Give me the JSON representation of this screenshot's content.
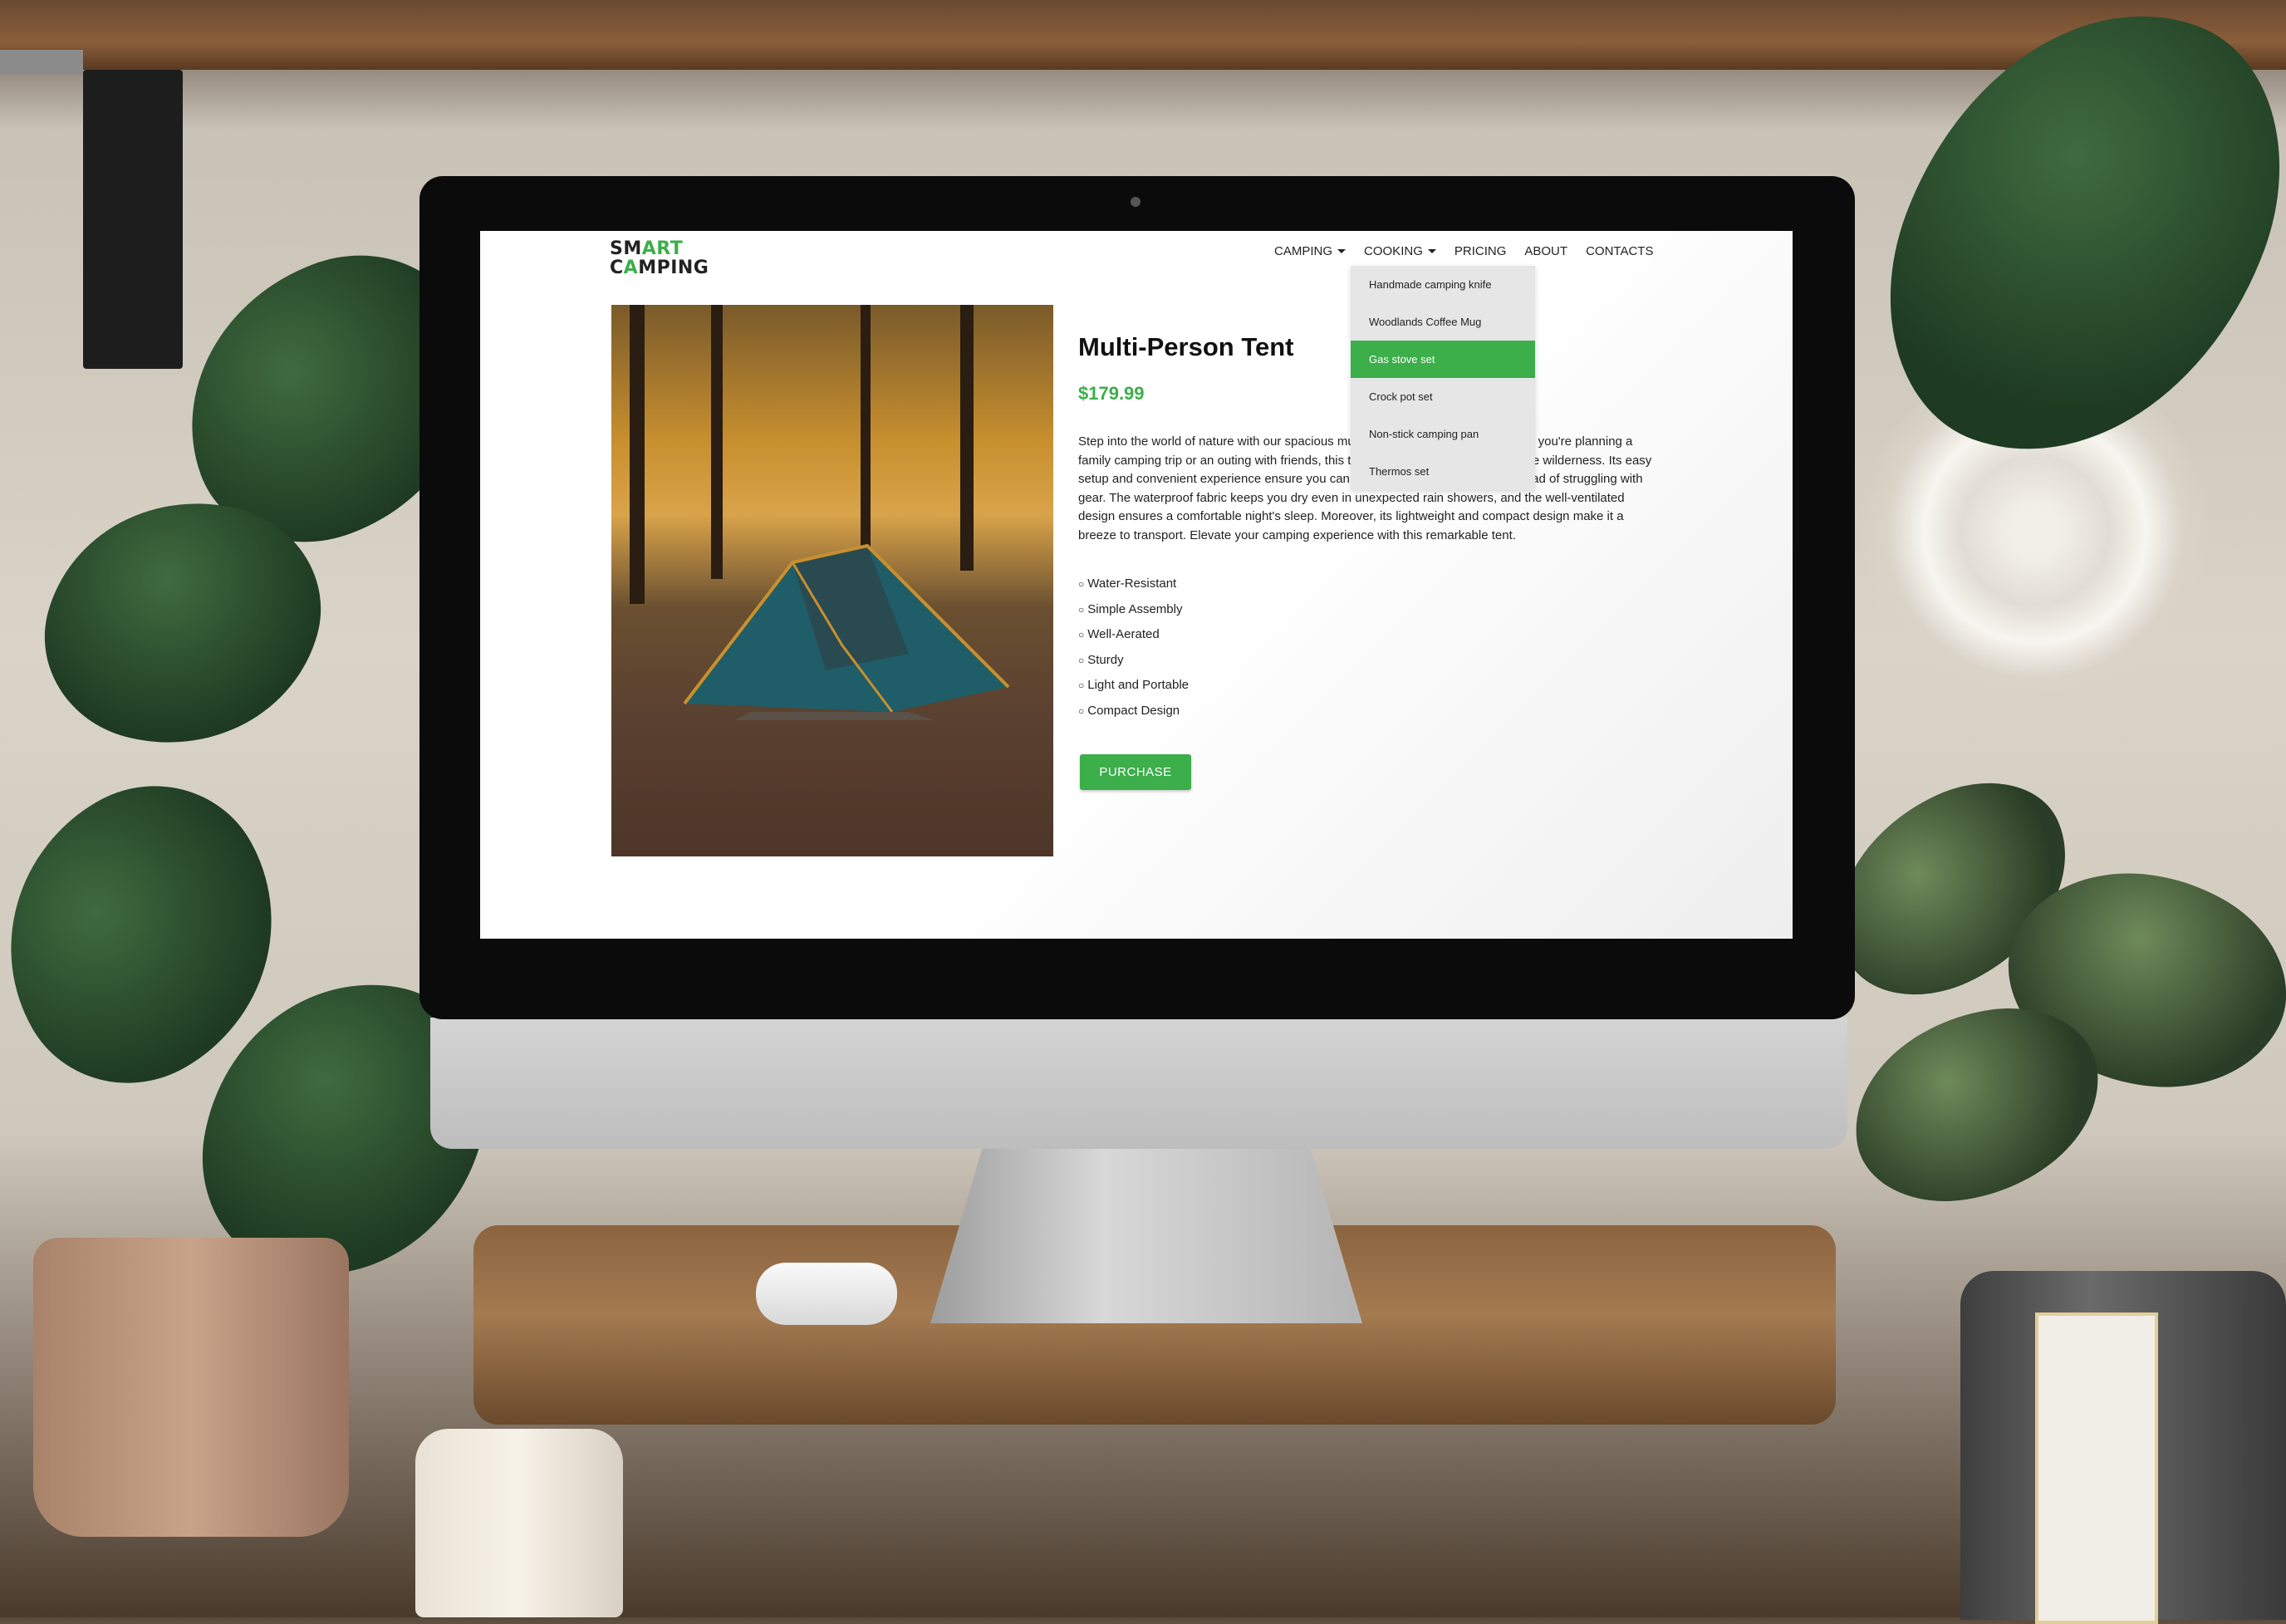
{
  "site": {
    "logo": {
      "line1_a": "SM",
      "line1_b": "ART",
      "line2_a": "C",
      "line2_b": "A",
      "line2_c": "MPING"
    },
    "nav": [
      {
        "label": "CAMPING",
        "has_dropdown": true
      },
      {
        "label": "COOKING",
        "has_dropdown": true
      },
      {
        "label": "PRICING",
        "has_dropdown": false
      },
      {
        "label": "ABOUT",
        "has_dropdown": false
      },
      {
        "label": "CONTACTS",
        "has_dropdown": false
      }
    ],
    "cooking_dropdown": [
      {
        "label": "Handmade camping knife",
        "active": false
      },
      {
        "label": "Woodlands Coffee Mug",
        "active": false
      },
      {
        "label": "Gas stove set",
        "active": true
      },
      {
        "label": "Crock pot set",
        "active": false
      },
      {
        "label": "Non-stick camping pan",
        "active": false
      },
      {
        "label": "Thermos set",
        "active": false
      }
    ]
  },
  "product": {
    "title": "Multi-Person Tent",
    "price": "$179.99",
    "description": "Step into the world of nature with our spacious multi-person camping tent. Whether you're planning a family camping trip or an outing with friends, this tent is your cozy shelter amidst the wilderness. Its easy setup and convenient experience ensure you can focus on making memories instead of struggling with gear. The waterproof fabric keeps you dry even in unexpected rain showers, and the well-ventilated design ensures a comfortable night's sleep. Moreover, its lightweight and compact design make it a breeze to transport. Elevate your camping experience with this remarkable tent.",
    "features": [
      "Water-Resistant",
      "Simple Assembly",
      "Well-Aerated",
      "Sturdy",
      "Light and Portable",
      "Compact Design"
    ],
    "purchase_label": "PURCHASE"
  },
  "colors": {
    "accent": "#3cae4a",
    "text": "#222222",
    "dropdown_bg": "#e6e6e6"
  }
}
